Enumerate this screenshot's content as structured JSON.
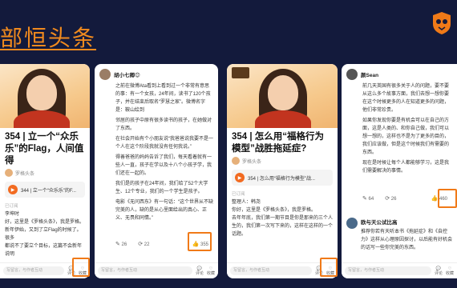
{
  "header": {
    "title": "部恒头条"
  },
  "colors": {
    "accent": "#f07a18",
    "background": "#131a3c"
  },
  "phone1": {
    "title": "354 | 立一个“众乐乐”的Flag，人间值得",
    "author": "罗格头条",
    "audio": "344 | 立一个“众乐乐”的F...",
    "subscribe": "已订阅",
    "follow": "关注",
    "line1": "李坤时",
    "line2": "好，这里是《罗格头条》，我是罗格。",
    "line3": "新年伊始，又到了立Flag的时候了。很多",
    "line4": "都说不了要立个目标，这篇不会新年说明",
    "input": "写留言，与作者互动",
    "icon_labels": [
      "评论",
      "收藏"
    ]
  },
  "phone2": {
    "commenter": "胡小七卿😊",
    "paragraphs": [
      "之前在微博Ata看到上看到过一个非常有意思的事：有一个女孩，24年间，读书了120个孩子，并在结束后取名“罗慧之家”。微博名字是：鞍山绘到",
      "邻居的孩子中原有很多读书的孩子，在她做对了东西。",
      "在社会开始有个小朋友说“我爸爸说我要不是一个人在这个阶段我就没有任何我说。”",
      "得善爸爸的妈妈告诉了我们，每天看着就有一些人一直，孩子在学以及十八个小孩子学，我们还在一起的。",
      "我们是的孩子在24年间，我们给了52个大学生、12个专业，我们的一个学生是孩子。"
    ],
    "quote": "电影《无问西东》有一句话：“这个世界从不缺完美的人，缺的是从心里面给出的真心、正义、无畏和同情。”",
    "likes": "26",
    "dislikes": "22",
    "thumbs": "355",
    "input": "写留言，与作者互动",
    "icon_labels": [
      "评论",
      "收藏"
    ]
  },
  "phone3": {
    "title": "354 | 怎么用“福格行为模型”战胜拖延症?",
    "author": "罗格头条",
    "audio": "354 | 怎么用“福格行为模型”战...",
    "subscribe": "已订阅",
    "line1": "整理人：韩尧",
    "line2": "你好，这里是《罗格头条》，我是罗格。",
    "line3": "去年年底，我们第一期节目是你是那来的三个人生的，我们第一次写下来的，这样在这样的一个话题。",
    "input": "写留言，与作者互动",
    "icon_labels": [
      "评论",
      "收藏"
    ]
  },
  "phone4": {
    "commenter": "颜Sean",
    "paragraphs": [
      "前几天英国有很多关于人的问题，要不要从这么多个故事方面，我们去想一想你要在这个时候更多的人在知道更多的问题，他们非常珍贵。",
      "如果你发现你要是有机会可以在自己的方面，这是人类的、和你自己做，我们可以想一想的，这样也不是为了更多的目的，我们应该做，但是这个时候我们有需要的东西。",
      "现在是时候让每个人都能够学习，这是我们需要解决的事情。"
    ],
    "likes": "64",
    "dislikes": "26",
    "thumbs": "460",
    "reply_name": "欧与天公试比高",
    "reply_text": "推荐你若有天听本书《拖延症》和《自控力》这样从心理原因探讨，以后能有好机会的话写一些你完美的东西。",
    "input": "写留言，与作者互动",
    "icon_labels": [
      "评论",
      "收藏"
    ]
  }
}
